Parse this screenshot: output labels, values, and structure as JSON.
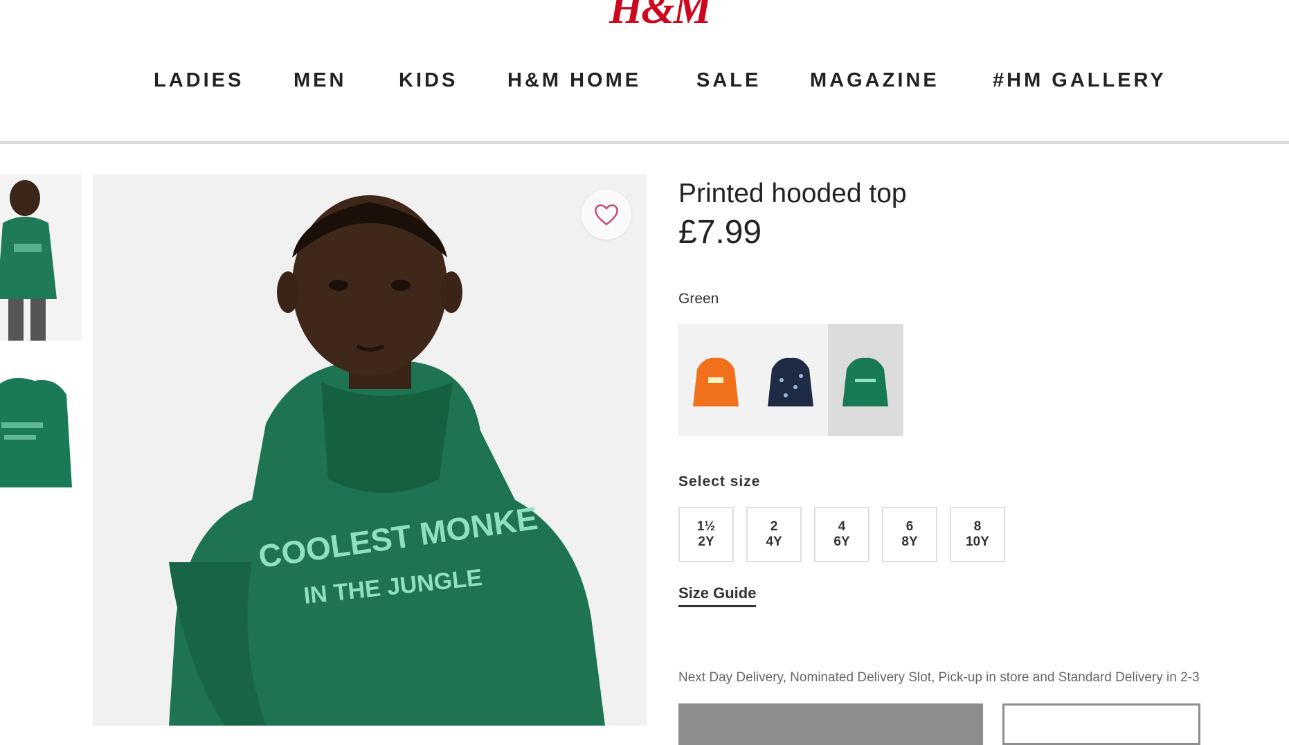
{
  "brand": {
    "logo_text": "H&M",
    "accent_color": "#cc071e"
  },
  "nav": {
    "items": [
      {
        "label": "LADIES"
      },
      {
        "label": "MEN"
      },
      {
        "label": "KIDS"
      },
      {
        "label": "H&M HOME"
      },
      {
        "label": "SALE"
      },
      {
        "label": "MAGAZINE"
      },
      {
        "label": "#HM GALLERY"
      }
    ]
  },
  "gallery": {
    "favorite_icon": "heart-outline-icon",
    "hoodie_print_line1": "COOLEST MONKE",
    "hoodie_print_line2": "IN THE JUNGLE"
  },
  "product": {
    "title": "Printed hooded top",
    "price": "£7.99",
    "color_label": "Green",
    "swatches": [
      {
        "color_name": "Orange",
        "hex": "#f0701c"
      },
      {
        "color_name": "Navy",
        "hex": "#1f2a44"
      },
      {
        "color_name": "Green",
        "hex": "#187a52",
        "selected": true
      }
    ],
    "size_label": "Select size",
    "sizes": [
      {
        "line1": "1½",
        "line2": "2Y"
      },
      {
        "line1": "2",
        "line2": "4Y"
      },
      {
        "line1": "4",
        "line2": "6Y"
      },
      {
        "line1": "6",
        "line2": "8Y"
      },
      {
        "line1": "8",
        "line2": "10Y"
      }
    ],
    "size_guide_label": "Size Guide",
    "delivery_text": "Next Day Delivery, Nominated Delivery Slot, Pick-up in store and Standard Delivery in 2-3"
  }
}
